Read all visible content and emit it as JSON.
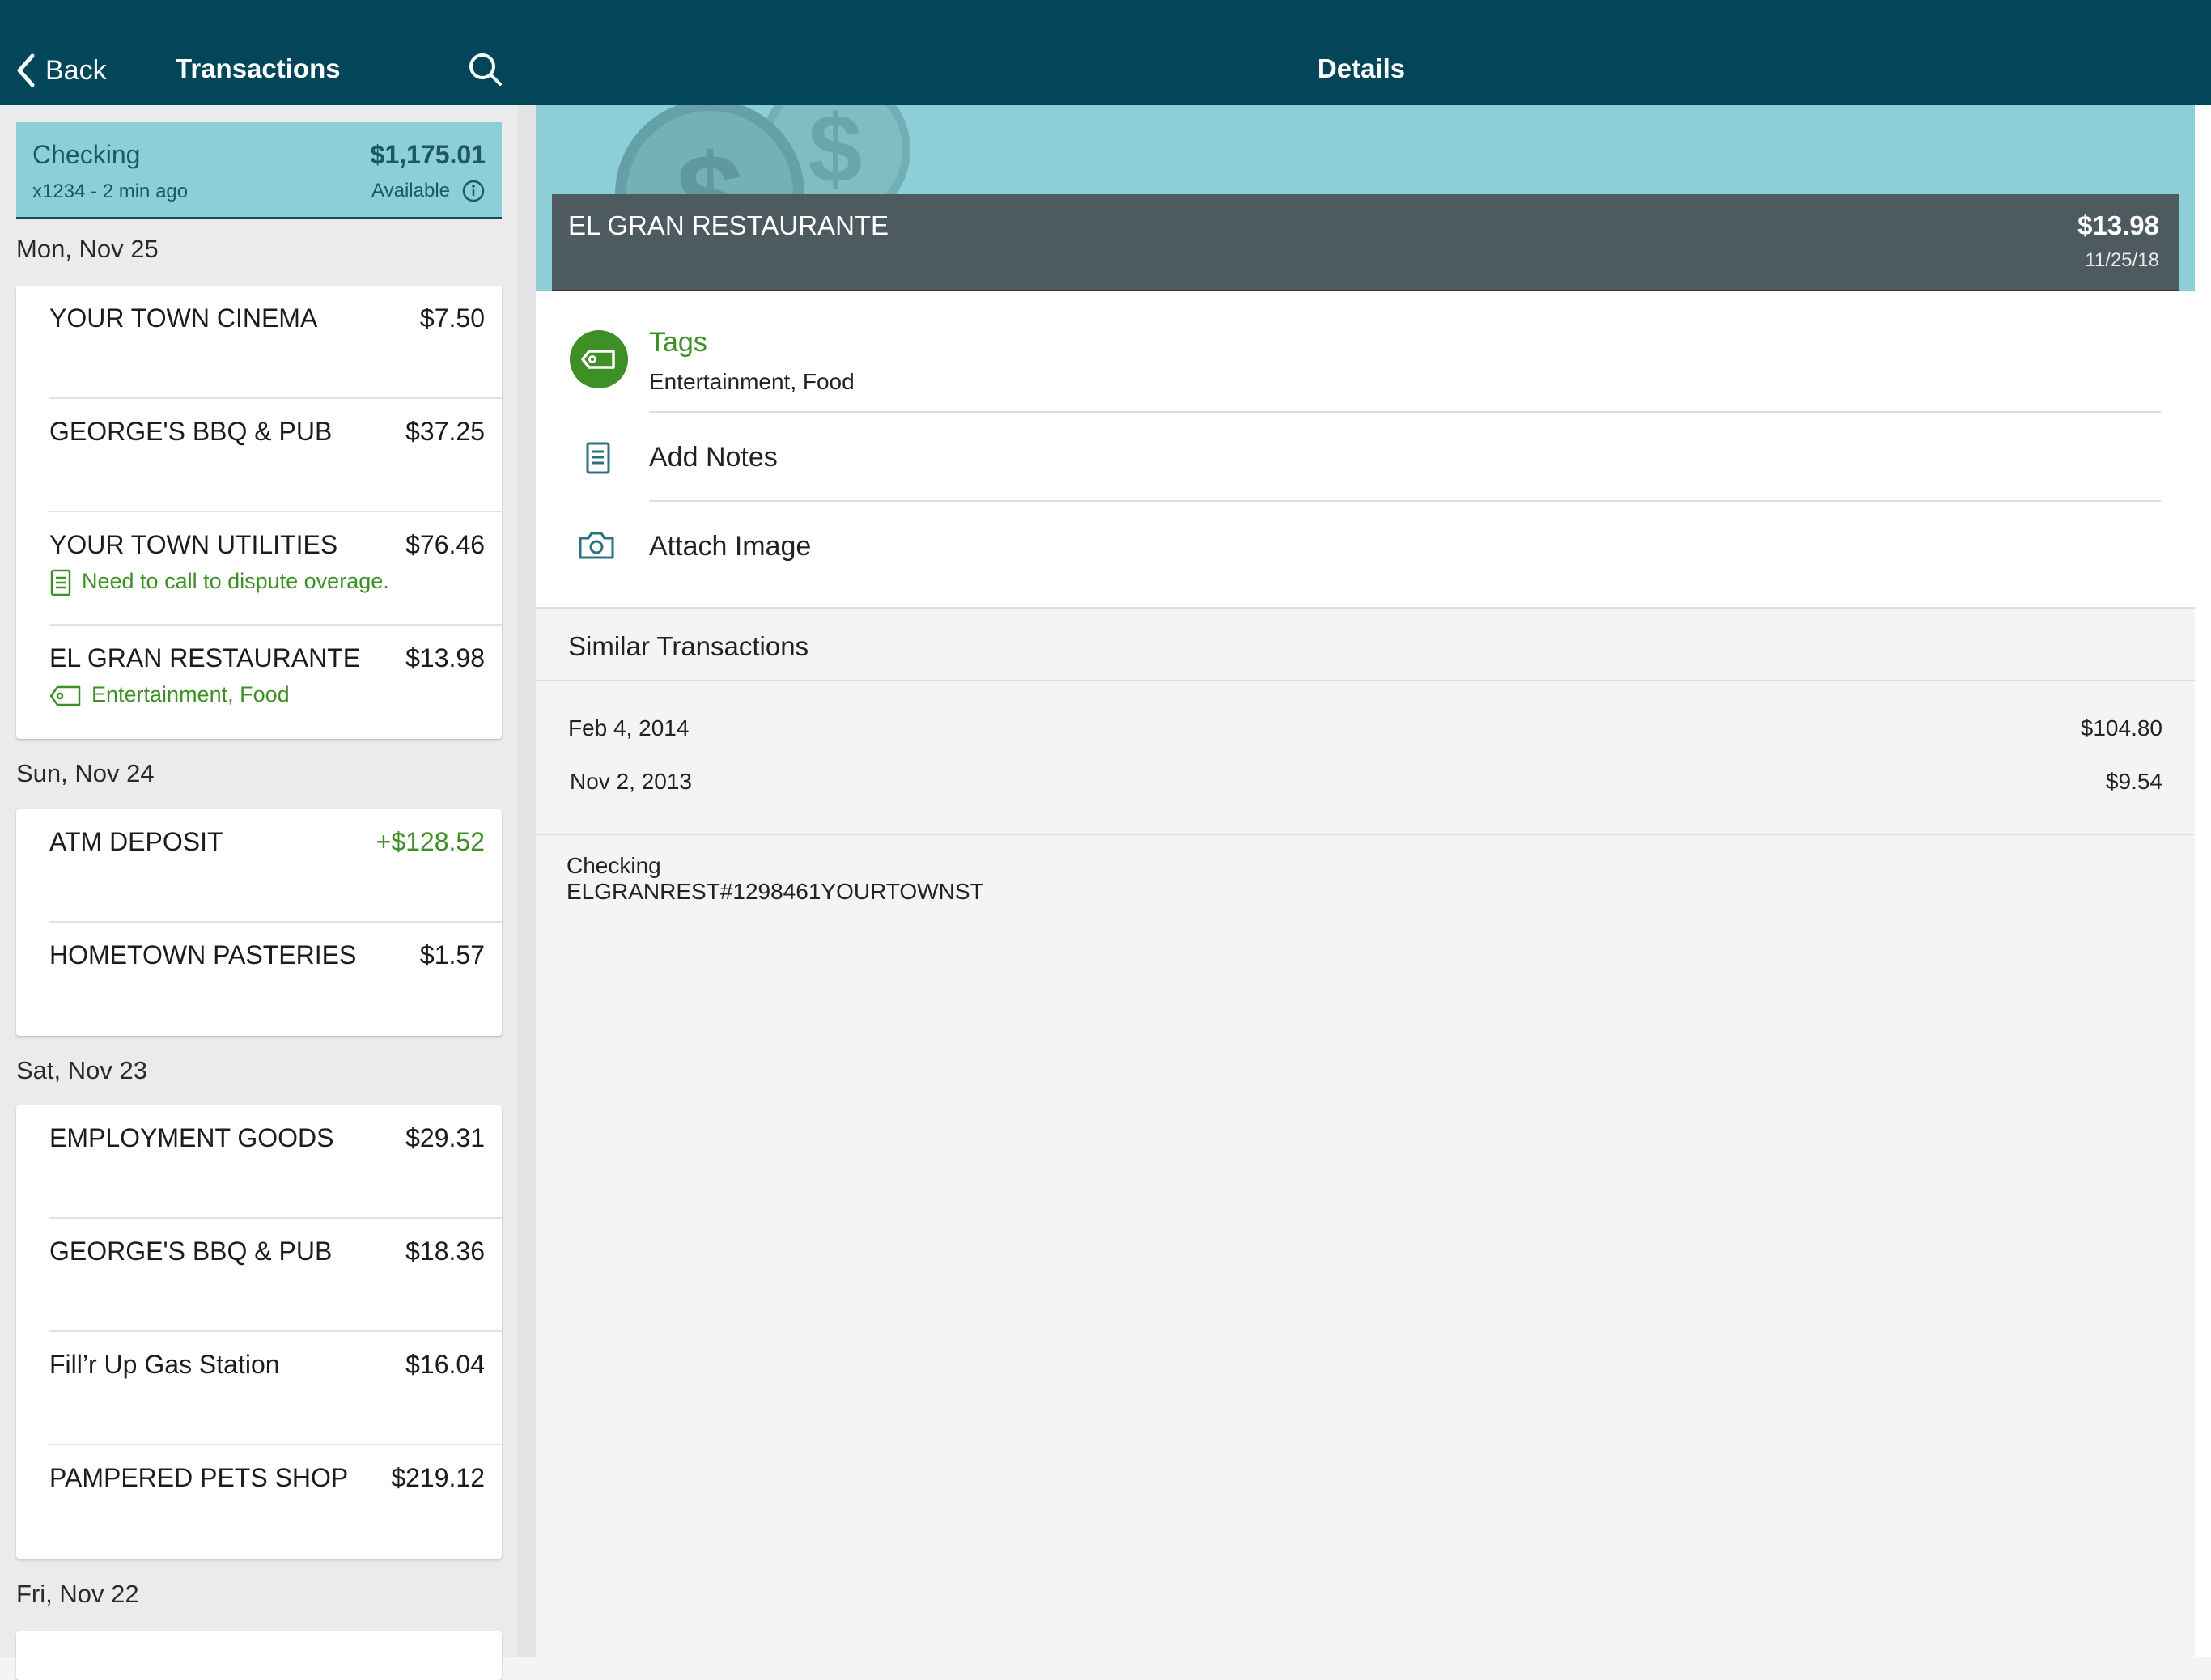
{
  "header": {
    "back_label": "Back",
    "left_title": "Transactions",
    "right_title": "Details"
  },
  "account": {
    "name": "Checking",
    "balance": "$1,175.01",
    "subtitle": "x1234 - 2 min ago",
    "available_label": "Available"
  },
  "days": [
    {
      "label": "Mon, Nov 25",
      "transactions": [
        {
          "name": "YOUR TOWN CINEMA",
          "amount": "$7.50"
        },
        {
          "name": "GEORGE'S BBQ & PUB",
          "amount": "$37.25"
        },
        {
          "name": "YOUR TOWN UTILITIES",
          "amount": "$76.46",
          "note": "Need to call to dispute overage."
        },
        {
          "name": "EL GRAN RESTAURANTE",
          "amount": "$13.98",
          "tags": "Entertainment, Food"
        }
      ]
    },
    {
      "label": "Sun, Nov 24",
      "transactions": [
        {
          "name": "ATM DEPOSIT",
          "amount": "+$128.52"
        },
        {
          "name": "HOMETOWN PASTERIES",
          "amount": "$1.57"
        }
      ]
    },
    {
      "label": "Sat, Nov 23",
      "transactions": [
        {
          "name": "EMPLOYMENT GOODS",
          "amount": "$29.31"
        },
        {
          "name": "GEORGE'S BBQ & PUB",
          "amount": "$18.36"
        },
        {
          "name": "Fill’r Up Gas Station",
          "amount": "$16.04"
        },
        {
          "name": "PAMPERED PETS SHOP",
          "amount": "$219.12"
        }
      ]
    },
    {
      "label": "Fri, Nov 22",
      "transactions": []
    }
  ],
  "details": {
    "merchant": "EL GRAN RESTAURANTE",
    "amount": "$13.98",
    "date": "11/25/18",
    "tags_label": "Tags",
    "tags_value": "Entertainment, Food",
    "add_notes_label": "Add Notes",
    "attach_image_label": "Attach Image",
    "similar_title": "Similar Transactions",
    "similar": [
      {
        "date": "Feb 4, 2014",
        "amount": "$104.80"
      },
      {
        "date": "Nov 2, 2013",
        "amount": "$9.54"
      }
    ],
    "account_name": "Checking",
    "description": "ELGRANREST#1298461YOURTOWNST"
  },
  "colors": {
    "header_bg": "#03465a",
    "banner": "#8ccfd7",
    "accent_green": "#3e8f26",
    "merchant_bar": "#4d5a5f"
  },
  "icons": [
    "chevron-left-icon",
    "search-icon",
    "info-icon",
    "tag-icon",
    "note-icon",
    "camera-icon",
    "dollar-coin-icon"
  ]
}
